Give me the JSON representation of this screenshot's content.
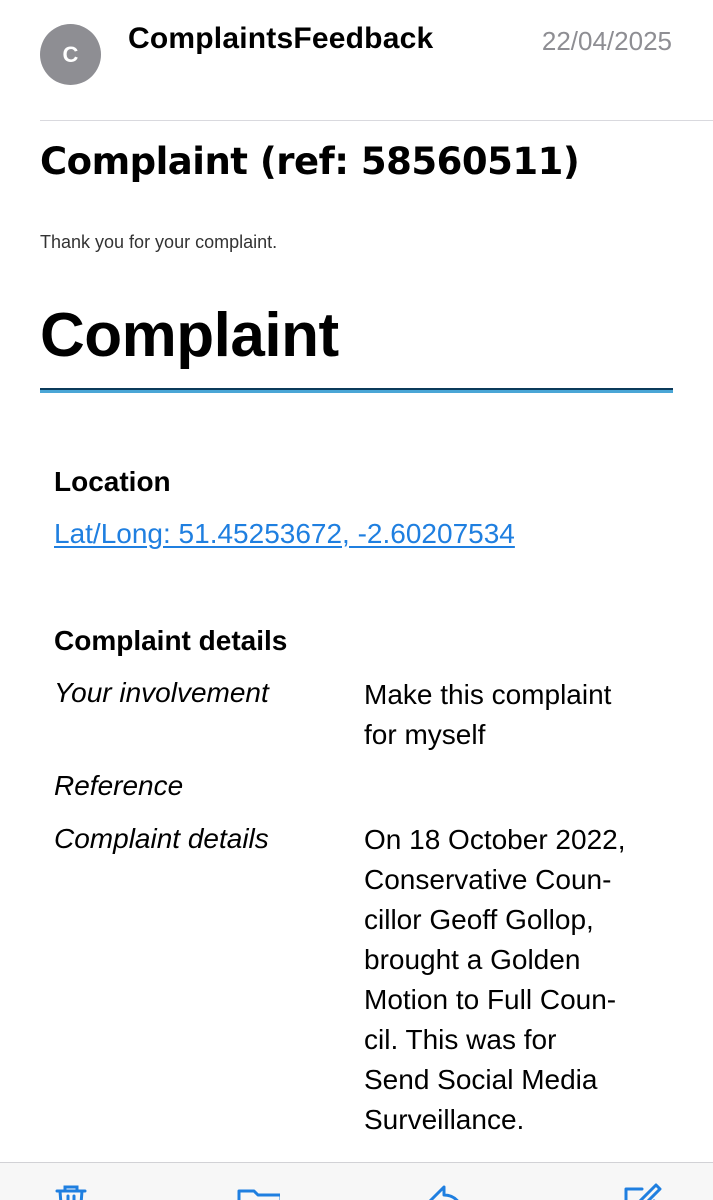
{
  "header": {
    "avatar_initial": "C",
    "sender": "ComplaintsFeedback",
    "date": "22/04/2025"
  },
  "email": {
    "subject": "Complaint (ref: 58560511)",
    "thanks": "Thank you for your complaint.",
    "heading": "Complaint",
    "location": {
      "title": "Location",
      "link": "Lat/Long: 51.45253672, -2.60207534"
    },
    "details": {
      "title": "Complaint details",
      "rows": [
        {
          "label": "Your involvement",
          "value_lines": [
            "Make this complaint",
            "for myself"
          ]
        },
        {
          "label": "Reference",
          "value_lines": []
        },
        {
          "label": "Complaint details",
          "value_lines": [
            "On 18 October 2022,",
            "Conservative Coun-",
            "cillor Geoff Gollop,",
            "brought a Golden",
            "Motion to Full Coun-",
            "cil. This was for",
            "Send Social Media",
            "Surveillance."
          ]
        }
      ]
    }
  },
  "toolbar": {
    "icons": [
      "trash-icon",
      "folder-icon",
      "reply-icon",
      "compose-icon"
    ],
    "accent": "#1f7fe0"
  },
  "colors": {
    "avatar": "#8e8e93",
    "link": "#1f7fe0",
    "rule_dark": "#0b3a5a",
    "rule_light": "#4aa6d6"
  }
}
